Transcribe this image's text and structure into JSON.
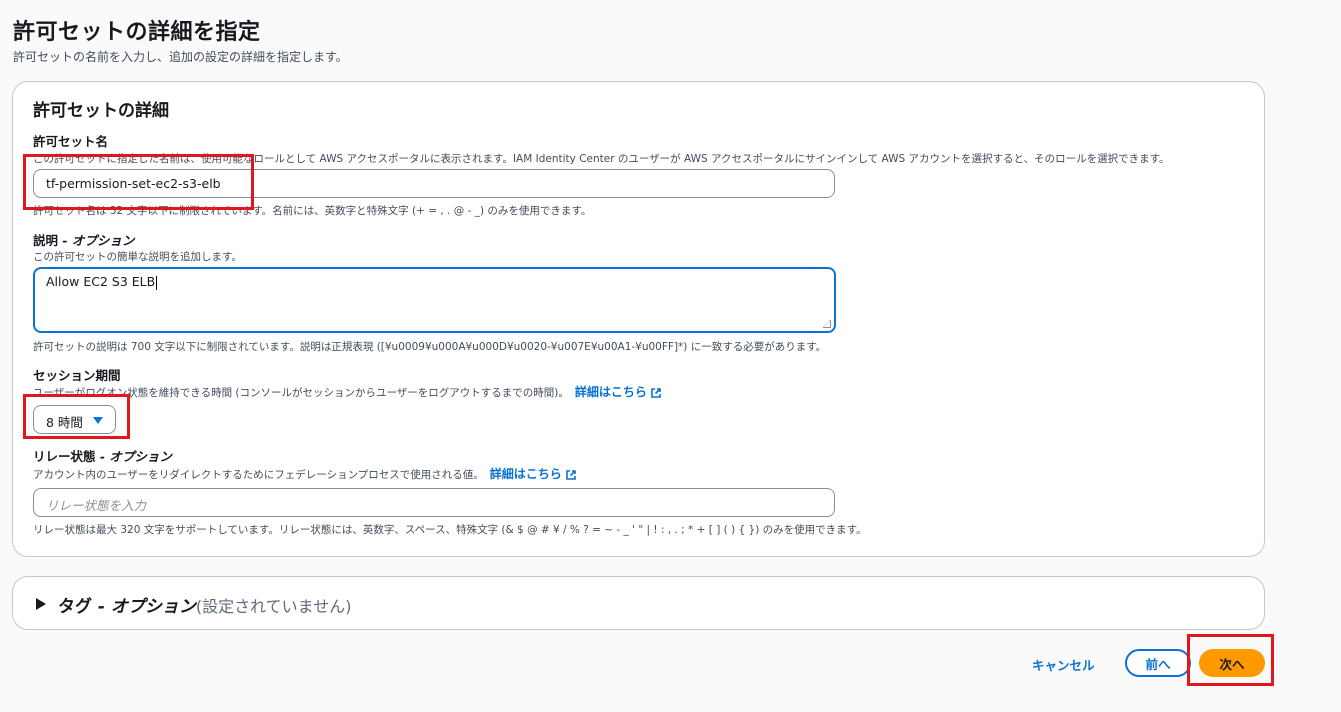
{
  "page": {
    "title": "許可セットの詳細を指定",
    "subtitle": "許可セットの名前を入力し、追加の設定の詳細を指定します。"
  },
  "details": {
    "title": "許可セットの詳細",
    "name": {
      "label": "許可セット名",
      "description": "この許可セットに指定した名前は、使用可能なロールとして AWS アクセスポータルに表示されます。IAM Identity Center のユーザーが AWS アクセスポータルにサインインして AWS アカウントを選択すると、そのロールを選択できます。",
      "value": "tf-permission-set-ec2-s3-elb",
      "constraint": "許可セット名は 32 文字以下に制限されています。名前には、英数字と特殊文字 (+ = , . @ - _) のみを使用できます。"
    },
    "description": {
      "label": "説明",
      "label_suffix": " - オプション",
      "hint": "この許可セットの簡単な説明を追加します。",
      "value": "Allow EC2 S3 ELB",
      "constraint": "許可セットの説明は 700 文字以下に制限されています。説明は正規表現 ([¥u0009¥u000A¥u000D¥u0020-¥u007E¥u00A1-¥u00FF]*) に一致する必要があります。"
    },
    "session": {
      "label": "セッション期間",
      "hint": "ユーザーがログオン状態を維持できる時間 (コンソールがセッションからユーザーをログアウトするまでの時間)。",
      "link": "詳細はこちら",
      "selected": "8 時間"
    },
    "relay": {
      "label": "リレー状態",
      "label_suffix": " - オプション",
      "hint": "アカウント内のユーザーをリダイレクトするためにフェデレーションプロセスで使用される値。",
      "link": "詳細はこちら",
      "placeholder": "リレー状態を入力",
      "constraint": "リレー状態は最大 320 文字をサポートしています。リレー状態には、英数字、スペース、特殊文字 (& $ @ # ¥ / % ? = ~ - _ ' \" | ! : , . ; * + [ ] ( ) { }) のみを使用できます。"
    }
  },
  "tags": {
    "title": "タグ",
    "title_suffix": " - オプション",
    "status": "(設定されていません)"
  },
  "footer": {
    "cancel": "キャンセル",
    "previous": "前へ",
    "next": "次へ"
  },
  "colors": {
    "accent": "#0972d3",
    "primary": "#ff9900",
    "highlight": "#e2161d"
  }
}
